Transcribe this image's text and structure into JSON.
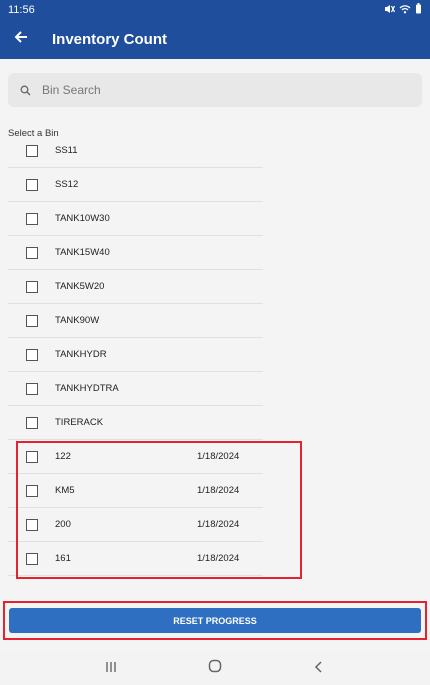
{
  "status_bar": {
    "time": "11:56"
  },
  "app_bar": {
    "title": "Inventory Count"
  },
  "search": {
    "placeholder": "Bin Search"
  },
  "section_label": "Select a Bin",
  "bins": [
    {
      "name": "SS11",
      "date": ""
    },
    {
      "name": "SS12",
      "date": ""
    },
    {
      "name": "TANK10W30",
      "date": ""
    },
    {
      "name": "TANK15W40",
      "date": ""
    },
    {
      "name": "TANK5W20",
      "date": ""
    },
    {
      "name": "TANK90W",
      "date": ""
    },
    {
      "name": "TANKHYDR",
      "date": ""
    },
    {
      "name": "TANKHYDTRA",
      "date": ""
    },
    {
      "name": "TIRERACK",
      "date": ""
    },
    {
      "name": "122",
      "date": "1/18/2024"
    },
    {
      "name": "KM5",
      "date": "1/18/2024"
    },
    {
      "name": "200",
      "date": "1/18/2024"
    },
    {
      "name": "161",
      "date": "1/18/2024"
    }
  ],
  "reset_button": {
    "label": "RESET PROGRESS"
  },
  "colors": {
    "primary": "#1f4f9c",
    "button": "#2f6fc1",
    "highlight": "#e3232e"
  }
}
